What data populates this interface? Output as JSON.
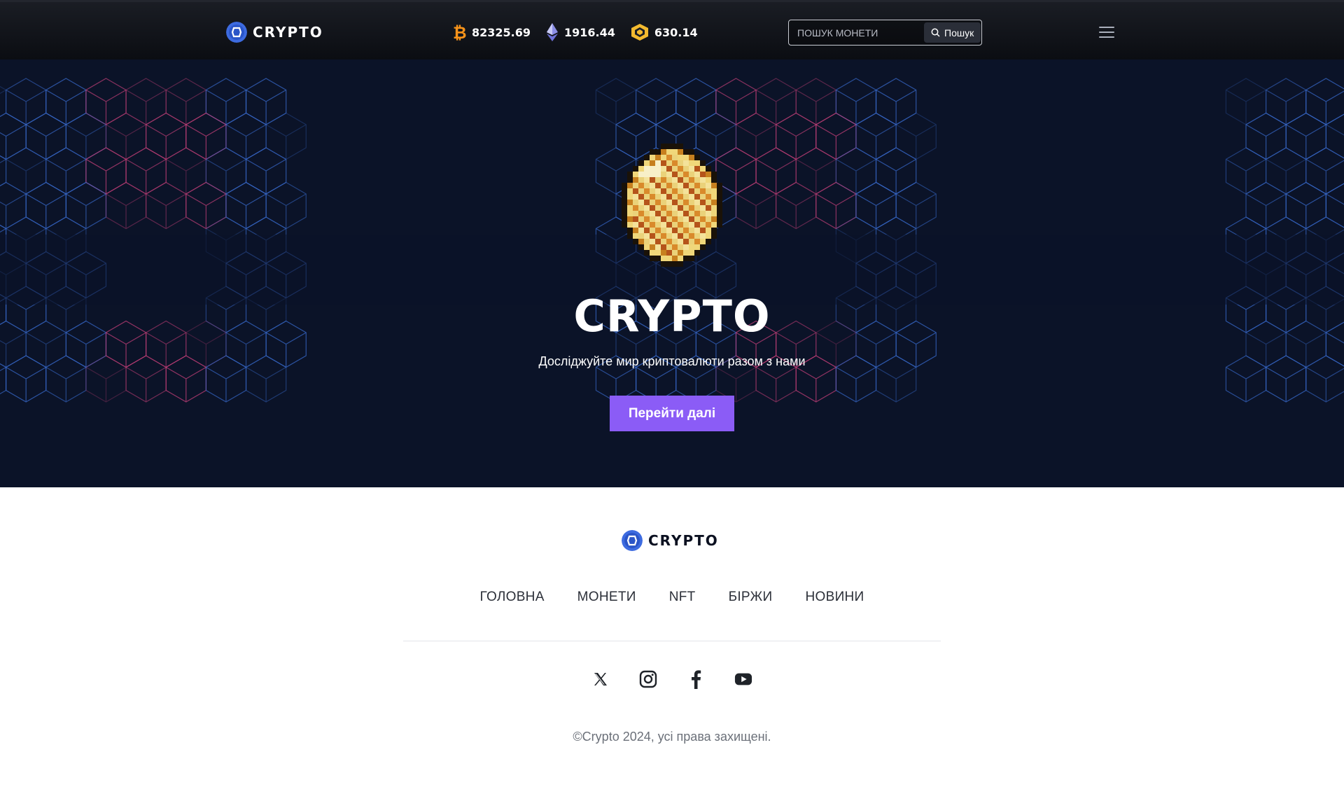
{
  "header": {
    "logo_text": "CRYPTO",
    "tickers": [
      {
        "icon": "bitcoin-icon",
        "value": "82325.69",
        "color": "#f7931a"
      },
      {
        "icon": "ethereum-icon",
        "value": "1916.44",
        "color": "#8c8fe6"
      },
      {
        "icon": "bnb-icon",
        "value": "630.14",
        "color": "#f3ba2f"
      }
    ],
    "search": {
      "placeholder": "ПОШУК МОНЕТИ",
      "button_label": "Пошук"
    }
  },
  "hero": {
    "title": "CRYPTO",
    "subtitle": "Досліджуйте мир криптовалюти разом з нами",
    "cta_label": "Перейти далі",
    "cta_color": "#8b5cf6"
  },
  "footer": {
    "logo_text": "CRYPTO",
    "nav": [
      "ГОЛОВНА",
      "МОНЕТИ",
      "NFT",
      "БІРЖИ",
      "НОВИНИ"
    ],
    "socials": [
      "x-icon",
      "instagram-icon",
      "facebook-icon",
      "youtube-icon"
    ],
    "copyright": "©Crypto 2024, усі права захищені."
  }
}
